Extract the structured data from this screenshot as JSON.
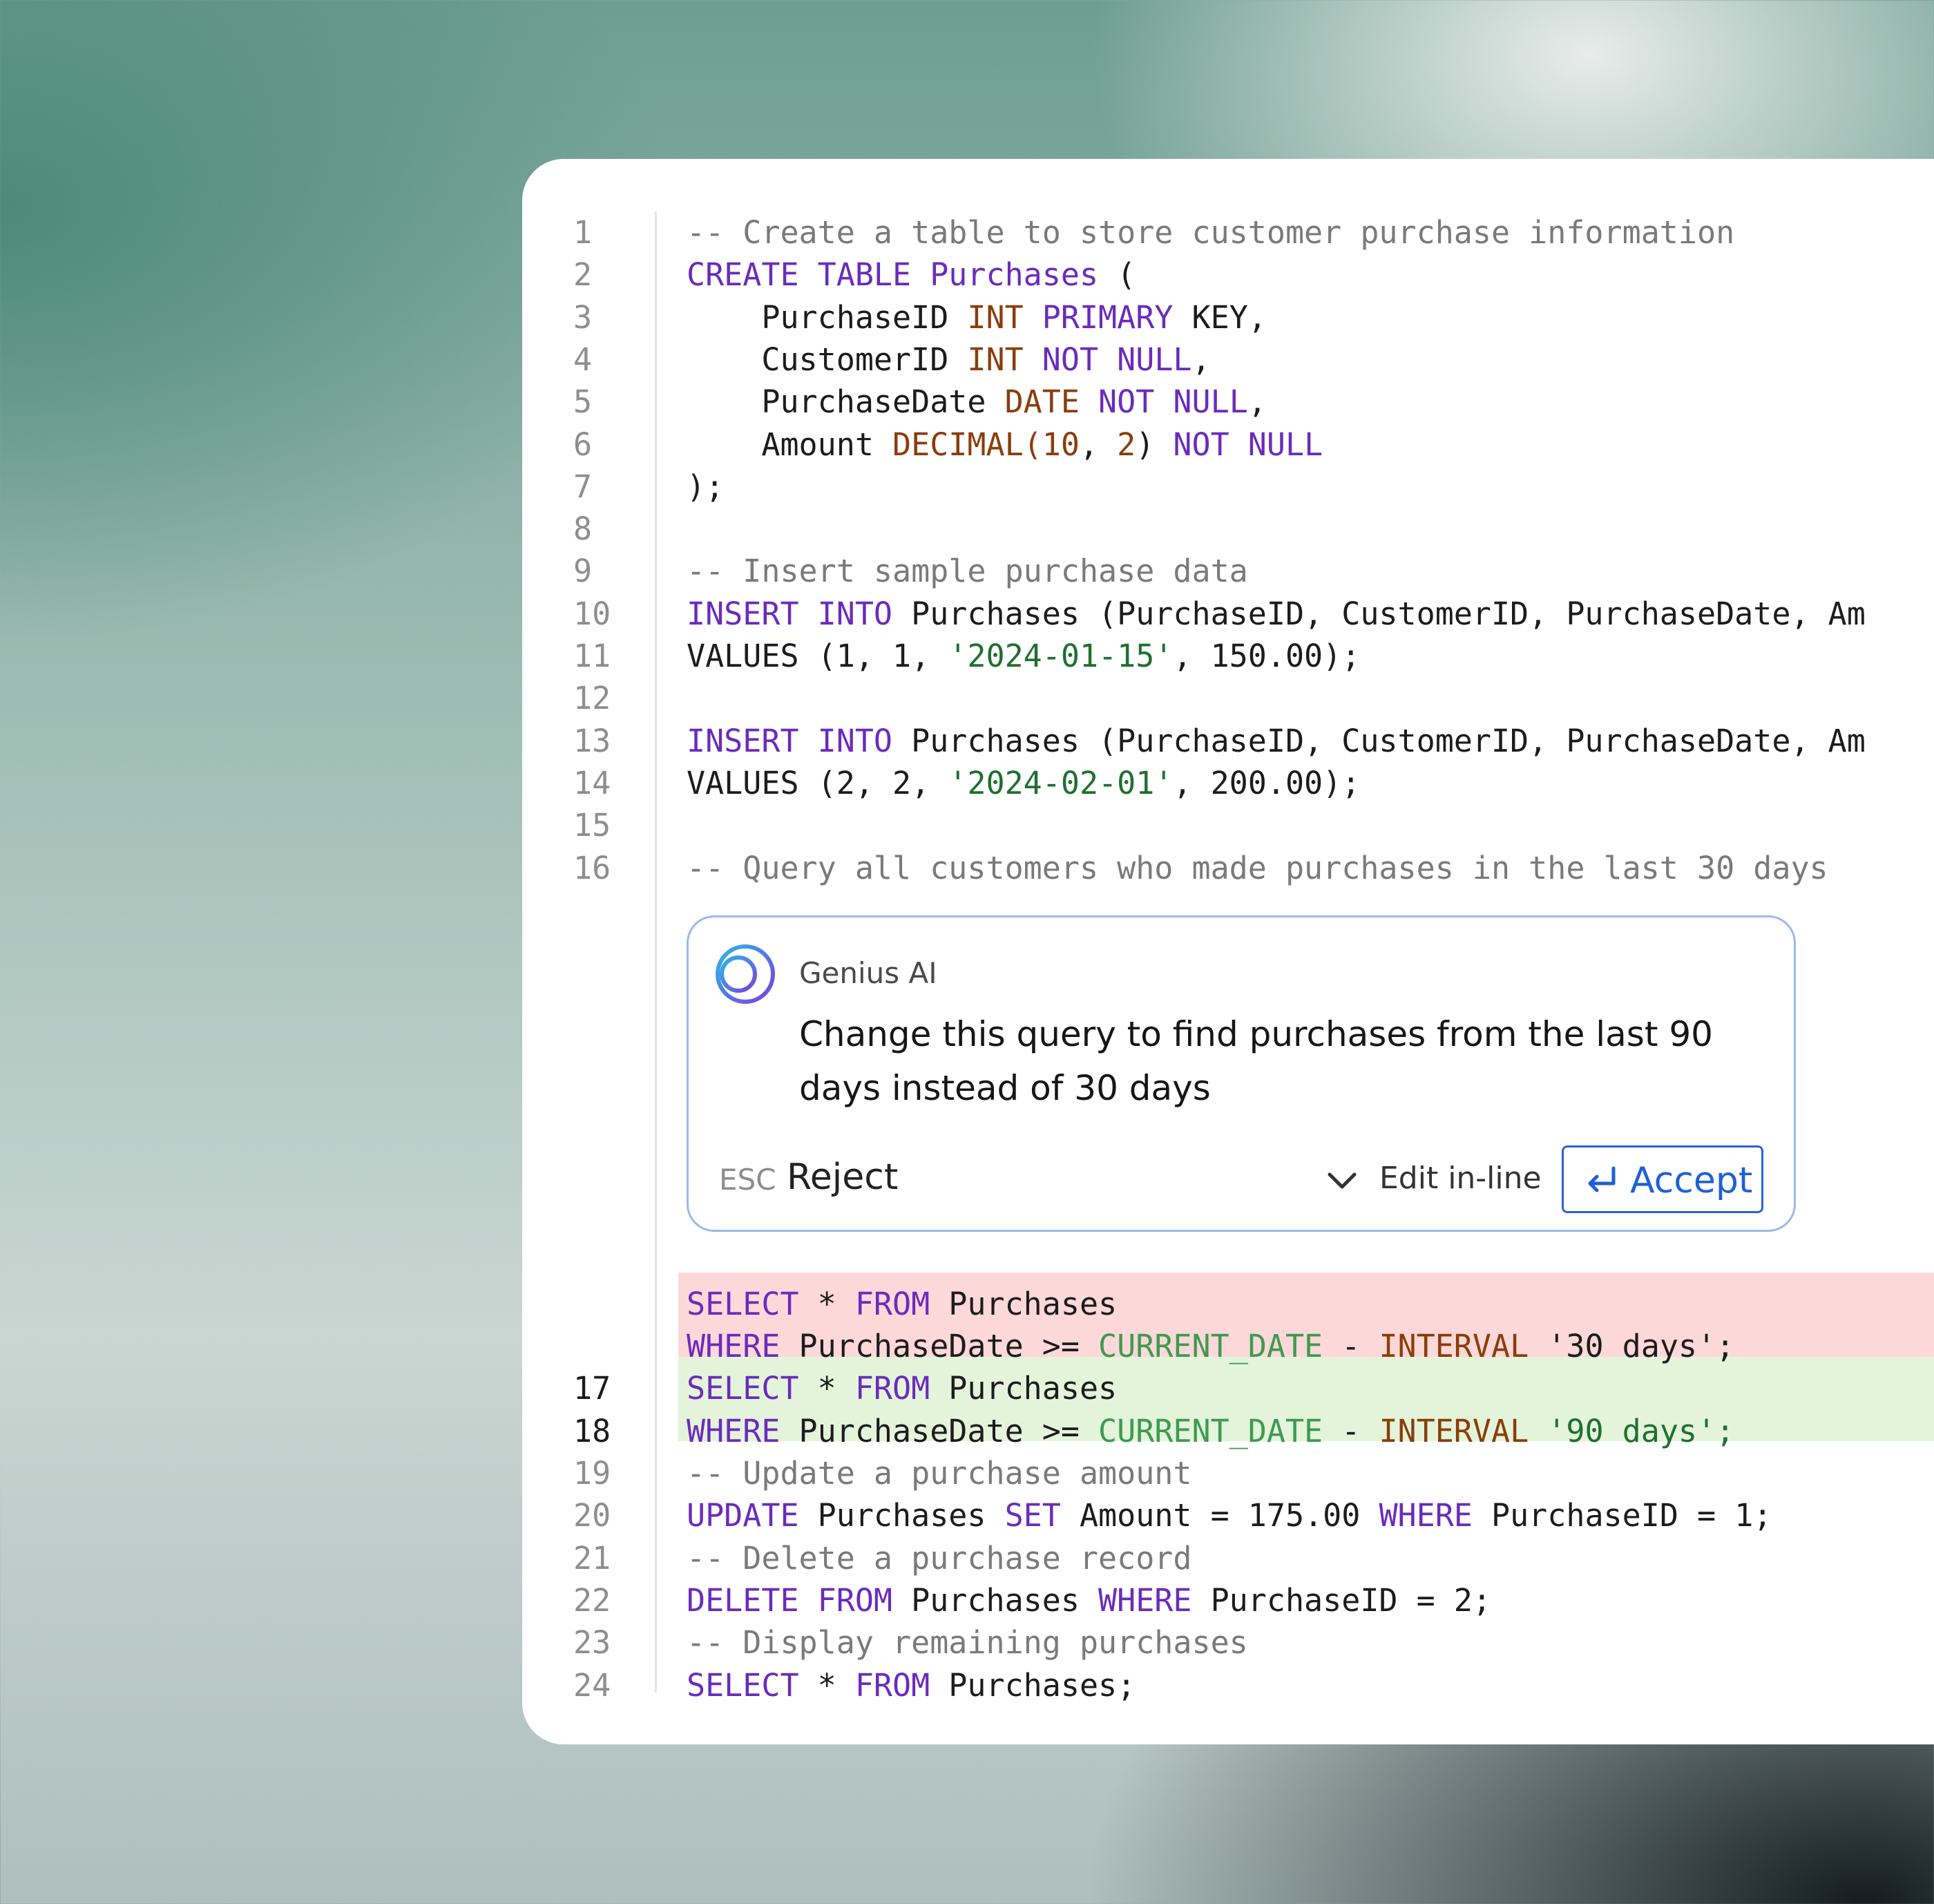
{
  "editor": {
    "lines": [
      {
        "n": "1",
        "tokens": [
          {
            "t": "-- Create a table to store customer purchase information",
            "c": "cmt"
          }
        ]
      },
      {
        "n": "2",
        "tokens": [
          {
            "t": "CREATE TABLE Purchases",
            "c": "kw"
          },
          {
            "t": " (",
            "c": ""
          }
        ]
      },
      {
        "n": "3",
        "tokens": [
          {
            "t": "    PurchaseID ",
            "c": ""
          },
          {
            "t": "INT",
            "c": "ty"
          },
          {
            "t": " PRIMARY",
            "c": "kw"
          },
          {
            "t": " KEY,",
            "c": ""
          }
        ]
      },
      {
        "n": "4",
        "tokens": [
          {
            "t": "    CustomerID ",
            "c": ""
          },
          {
            "t": "INT",
            "c": "ty"
          },
          {
            "t": " NOT NULL",
            "c": "kw"
          },
          {
            "t": ",",
            "c": ""
          }
        ]
      },
      {
        "n": "5",
        "tokens": [
          {
            "t": "    PurchaseDate ",
            "c": ""
          },
          {
            "t": "DATE",
            "c": "ty"
          },
          {
            "t": " NOT NULL",
            "c": "kw"
          },
          {
            "t": ",",
            "c": ""
          }
        ]
      },
      {
        "n": "6",
        "tokens": [
          {
            "t": "    Amount ",
            "c": ""
          },
          {
            "t": "DECIMAL(10",
            "c": "ty"
          },
          {
            "t": ", ",
            "c": ""
          },
          {
            "t": "2",
            "c": "ty"
          },
          {
            "t": ") ",
            "c": ""
          },
          {
            "t": "NOT NULL",
            "c": "kw"
          }
        ]
      },
      {
        "n": "7",
        "tokens": [
          {
            "t": ");",
            "c": ""
          }
        ]
      },
      {
        "n": "8",
        "tokens": []
      },
      {
        "n": "9",
        "tokens": [
          {
            "t": "-- Insert sample purchase data",
            "c": "cmt"
          }
        ]
      },
      {
        "n": "10",
        "tokens": [
          {
            "t": "INSERT INTO",
            "c": "kw"
          },
          {
            "t": " Purchases (PurchaseID, CustomerID, PurchaseDate, Am",
            "c": ""
          }
        ]
      },
      {
        "n": "11",
        "tokens": [
          {
            "t": "VALUES (1, 1, ",
            "c": ""
          },
          {
            "t": "'2024-01-15'",
            "c": "str"
          },
          {
            "t": ", 150.00);",
            "c": ""
          }
        ]
      },
      {
        "n": "12",
        "tokens": []
      },
      {
        "n": "13",
        "tokens": [
          {
            "t": "INSERT INTO",
            "c": "kw"
          },
          {
            "t": " Purchases (PurchaseID, CustomerID, PurchaseDate, Am",
            "c": ""
          }
        ]
      },
      {
        "n": "14",
        "tokens": [
          {
            "t": "VALUES (2, 2, ",
            "c": ""
          },
          {
            "t": "'2024-02-01'",
            "c": "str"
          },
          {
            "t": ", 200.00);",
            "c": ""
          }
        ]
      },
      {
        "n": "15",
        "tokens": []
      },
      {
        "n": "16",
        "tokens": [
          {
            "t": "-- Query all customers who made purchases in the last 30 days",
            "c": "cmt"
          }
        ]
      }
    ],
    "diff_removed": [
      {
        "n": "",
        "tokens": [
          {
            "t": "SELECT",
            "c": "kw"
          },
          {
            "t": " * ",
            "c": ""
          },
          {
            "t": "FROM",
            "c": "kw"
          },
          {
            "t": " Purchases",
            "c": ""
          }
        ]
      },
      {
        "n": "",
        "tokens": [
          {
            "t": "WHERE",
            "c": "kw"
          },
          {
            "t": " PurchaseDate >= ",
            "c": ""
          },
          {
            "t": "CURRENT_DATE",
            "c": "fn"
          },
          {
            "t": " - ",
            "c": ""
          },
          {
            "t": "INTERVAL",
            "c": "kw2"
          },
          {
            "t": " '30 days';",
            "c": ""
          }
        ]
      }
    ],
    "diff_added": [
      {
        "n": "17",
        "tokens": [
          {
            "t": "SELECT",
            "c": "kw"
          },
          {
            "t": " * ",
            "c": ""
          },
          {
            "t": "FROM",
            "c": "kw"
          },
          {
            "t": " Purchases",
            "c": ""
          }
        ]
      },
      {
        "n": "18",
        "tokens": [
          {
            "t": "WHERE",
            "c": "kw"
          },
          {
            "t": " PurchaseDate >= ",
            "c": ""
          },
          {
            "t": "CURRENT_DATE",
            "c": "fn"
          },
          {
            "t": " - ",
            "c": ""
          },
          {
            "t": "INTERVAL",
            "c": "kw2"
          },
          {
            "t": " '90 days';",
            "c": "str"
          }
        ]
      }
    ],
    "lines_after": [
      {
        "n": "19",
        "tokens": [
          {
            "t": "-- Update a purchase amount",
            "c": "cmt"
          }
        ]
      },
      {
        "n": "20",
        "tokens": [
          {
            "t": "UPDATE",
            "c": "kw"
          },
          {
            "t": " Purchases ",
            "c": ""
          },
          {
            "t": "SET",
            "c": "kw"
          },
          {
            "t": " Amount = 175.00 ",
            "c": ""
          },
          {
            "t": "WHERE",
            "c": "kw"
          },
          {
            "t": " PurchaseID = 1;",
            "c": ""
          }
        ]
      },
      {
        "n": "21",
        "tokens": [
          {
            "t": "-- Delete a purchase record",
            "c": "cmt"
          }
        ]
      },
      {
        "n": "22",
        "tokens": [
          {
            "t": "DELETE FROM",
            "c": "kw"
          },
          {
            "t": " Purchases ",
            "c": ""
          },
          {
            "t": "WHERE",
            "c": "kw"
          },
          {
            "t": " PurchaseID = 2;",
            "c": ""
          }
        ]
      },
      {
        "n": "23",
        "tokens": [
          {
            "t": "-- Display remaining purchases",
            "c": "cmt"
          }
        ]
      },
      {
        "n": "24",
        "tokens": [
          {
            "t": "SELECT",
            "c": "kw"
          },
          {
            "t": " * ",
            "c": ""
          },
          {
            "t": "FROM",
            "c": "kw"
          },
          {
            "t": " Purchases;",
            "c": ""
          }
        ]
      }
    ]
  },
  "ai_panel": {
    "name": "Genius AI",
    "message": "Change this query to find purchases from the last 90 days instead of 30 days",
    "esc_key": "ESC",
    "reject_label": "Reject",
    "edit_inline_label": "Edit in-line",
    "accept_label": "Accept",
    "logo_icon": "genius-logo-icon",
    "colors": {
      "border": "#9ab9ec",
      "accent": "#1f5fd8"
    }
  },
  "colors": {
    "keyword": "#6a2bbd",
    "type": "#8a3d0a",
    "string": "#1f6f2e",
    "comment": "#7a7a7a",
    "diff_removed_bg": "#fdd8d8",
    "diff_added_bg": "#e3f4da"
  }
}
